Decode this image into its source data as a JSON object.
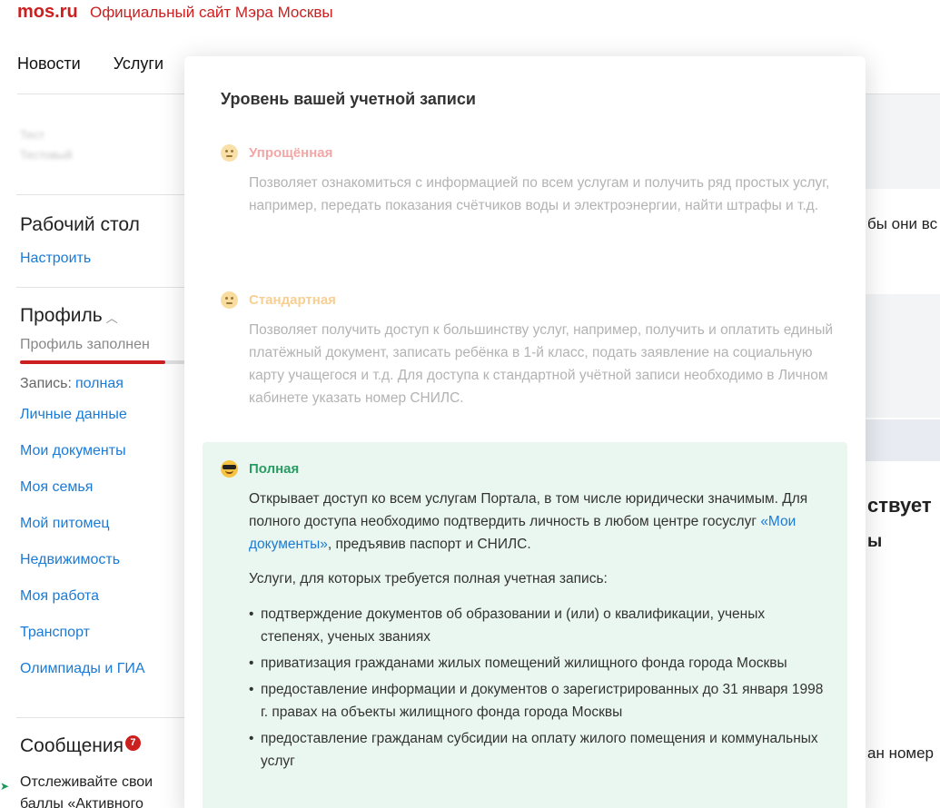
{
  "header": {
    "logo": "mos.ru",
    "site_title": "Официальный сайт Мэра Москвы"
  },
  "topnav": {
    "items": [
      "Новости",
      "Услуги"
    ]
  },
  "sidebar": {
    "blurred_lines": [
      "Тест",
      "Тестовый"
    ],
    "desktop_title": "Рабочий стол",
    "desktop_link": "Настроить",
    "profile_title": "Профиль",
    "profile_progress_label": "Профиль заполнен",
    "profile_progress": 0.88,
    "record_label": "Запись:",
    "record_value": "полная",
    "menu": [
      "Личные данные",
      "Мои документы",
      "Моя семья",
      "Мой питомец",
      "Недвижимость",
      "Моя работа",
      "Транспорт",
      "Олимпиады и ГИА"
    ],
    "messages_title": "Сообщения",
    "messages_count": "7",
    "messages_text": "Отслеживайте свои баллы «Активного"
  },
  "background_right": {
    "text1": "бы они вс",
    "text2": "ствует",
    "text3": "ы",
    "text4": "ан номер"
  },
  "modal": {
    "title": "Уровень вашей учетной записи",
    "levels": [
      {
        "name": "Упрощённая",
        "description": "Позволяет ознакомиться с информацией по всем услугам и получить ряд простых услуг, например, передать показания счётчиков воды и электроэнергии, найти штрафы и т.д."
      },
      {
        "name": "Стандартная",
        "description": "Позволяет получить доступ к большинству услуг, например, получить и оплатить единый платёжный документ, записать ребёнка в 1-й класс, подать заявление на социальную карту учащегося и т.д. Для доступа к стандартной учётной записи необходимо в Личном кабинете указать номер СНИЛС."
      },
      {
        "name": "Полная",
        "description_before": "Открывает доступ ко всем услугам Портала, в том числе юридически значимым. Для полного доступа необходимо подтвердить личность в любом центре госуслуг ",
        "description_link": "«Мои документы»",
        "description_after": ", предъявив паспорт и СНИЛС.",
        "services_intro": "Услуги, для которых требуется полная учетная запись:",
        "services": [
          "подтверждение документов об образовании и (или) о квалификации, ученых степенях, ученых званиях",
          "приватизация гражданами жилых помещений жилищного фонда города Москвы",
          "предоставление информации и документов о зарегистрированных до 31 января 1998 г. правах на объекты жилищного фонда города Москвы",
          "предоставление гражданам субсидии на оплату жилого помещения и коммунальных услуг"
        ]
      }
    ]
  },
  "colors": {
    "brand": "#cc1f1f",
    "link": "#1a7bd6",
    "full_accent": "#2a9c63",
    "full_bg": "#eaf7f0"
  }
}
